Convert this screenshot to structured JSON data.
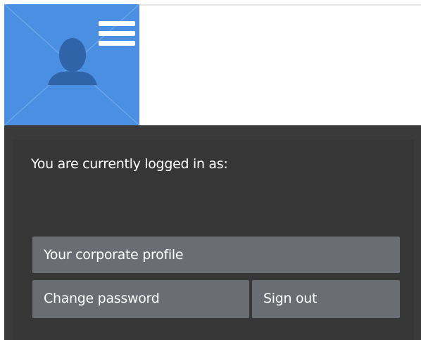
{
  "account_panel": {
    "logged_in_label": "You are currently logged in as:",
    "buttons": {
      "profile": "Your corporate profile",
      "change_password": "Change password",
      "sign_out": "Sign out"
    }
  },
  "icons": {
    "avatar": "user-silhouette-icon",
    "menu": "hamburger-menu-icon"
  },
  "colors": {
    "avatar_bg": "#4a8fe2",
    "panel_bg": "#3a3a3a",
    "button_bg": "#6a6d71"
  }
}
